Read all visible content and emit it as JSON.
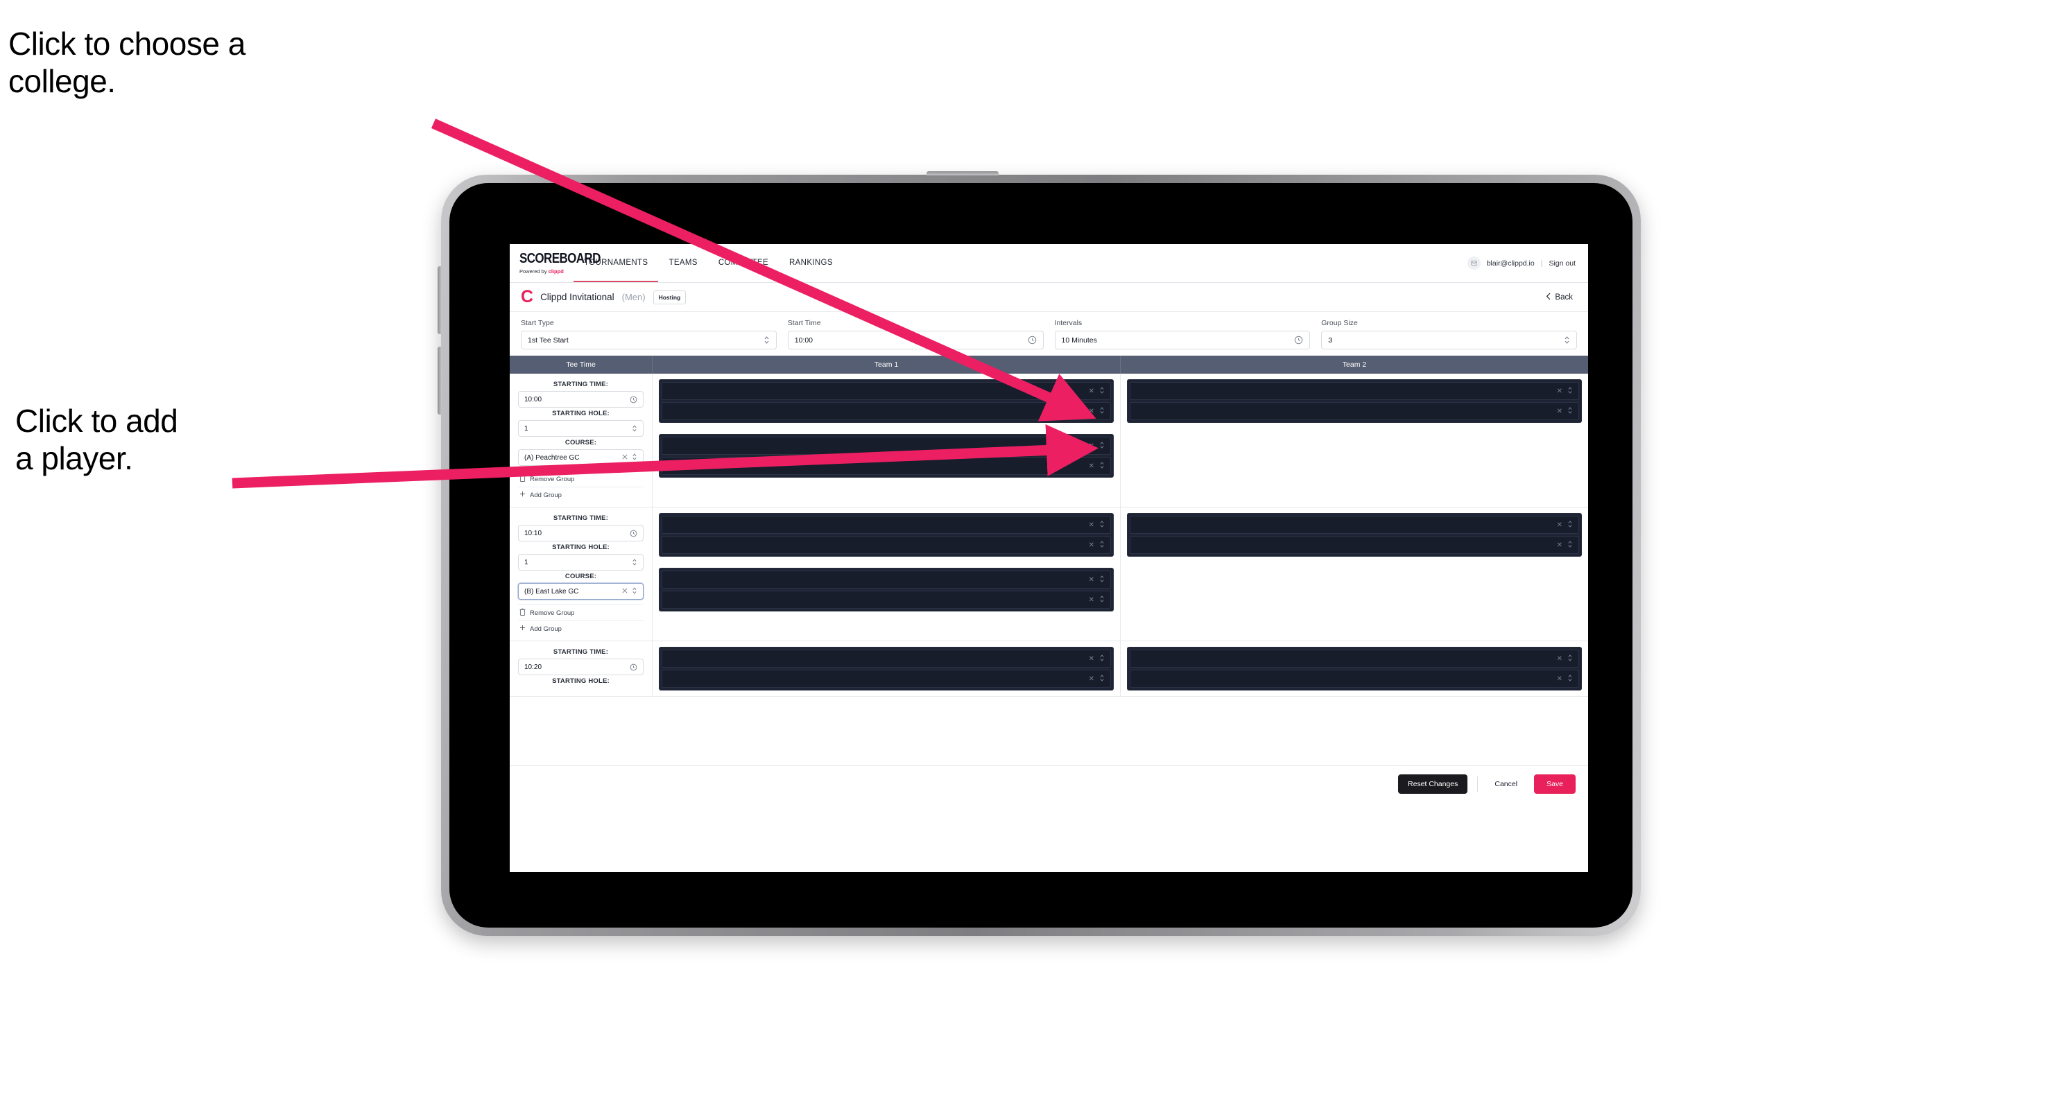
{
  "annotations": [
    {
      "id": "college",
      "text": "Click to choose a\ncollege."
    },
    {
      "id": "player",
      "text": "Click to add\na player."
    }
  ],
  "annotation_color": "#ec1f63",
  "accent_color": "#e8215a",
  "header_bar_color": "#555e72",
  "topnav": {
    "brand_word": "SCOREBOARD",
    "brand_sub_prefix": "Powered by ",
    "brand_sub_name": "clippd",
    "tabs": [
      {
        "label": "TOURNAMENTS",
        "active": true
      },
      {
        "label": "TEAMS",
        "active": false
      },
      {
        "label": "COMMITTEE",
        "active": false
      },
      {
        "label": "RANKINGS",
        "active": false
      }
    ],
    "avatar_icon": "user-icon",
    "account_email": "blair@clippd.io",
    "separator": "|",
    "sign_out": "Sign out"
  },
  "titlebar": {
    "logo_letter": "C",
    "tournament_name": "Clippd Invitational",
    "gender": "(Men)",
    "badge": "Hosting",
    "back_label": "Back",
    "back_icon": "chevron-left-icon"
  },
  "controls": [
    {
      "label": "Start Type",
      "value": "1st Tee Start",
      "icon": "chevron-updown-icon"
    },
    {
      "label": "Start Time",
      "value": "10:00",
      "icon": "clock-icon"
    },
    {
      "label": "Intervals",
      "value": "10 Minutes",
      "icon": "clock-icon"
    },
    {
      "label": "Group Size",
      "value": "3",
      "icon": "chevron-updown-icon"
    }
  ],
  "table": {
    "columns": [
      "Tee Time",
      "Team 1",
      "Team 2"
    ],
    "field_labels": {
      "starting_time": "STARTING TIME:",
      "starting_hole": "STARTING HOLE:",
      "course": "COURSE:"
    },
    "group_actions": {
      "remove": "Remove Group",
      "remove_icon": "trash-icon",
      "add": "Add Group",
      "add_icon": "plus-icon"
    },
    "slot_icons": {
      "clear": "close-icon",
      "expand": "chevron-updown-icon"
    },
    "rows": [
      {
        "starting_time": "10:00",
        "starting_hole": "1",
        "course": "(A) Peachtree GC",
        "course_focused": false,
        "show_actions": true,
        "team1_cards": [
          {
            "slots": 2
          },
          {
            "slots": 2
          }
        ],
        "team2_cards": [
          {
            "slots": 2
          }
        ]
      },
      {
        "starting_time": "10:10",
        "starting_hole": "1",
        "course": "(B) East Lake GC",
        "course_focused": true,
        "show_actions": true,
        "team1_cards": [
          {
            "slots": 2
          },
          {
            "slots": 2
          }
        ],
        "team2_cards": [
          {
            "slots": 2
          }
        ]
      },
      {
        "starting_time": "10:20",
        "starting_hole": "",
        "course": "",
        "course_focused": false,
        "show_actions": false,
        "team1_cards": [
          {
            "slots": 2
          }
        ],
        "team2_cards": [
          {
            "slots": 2
          }
        ]
      }
    ]
  },
  "footer": {
    "reset": "Reset Changes",
    "cancel": "Cancel",
    "save": "Save"
  }
}
